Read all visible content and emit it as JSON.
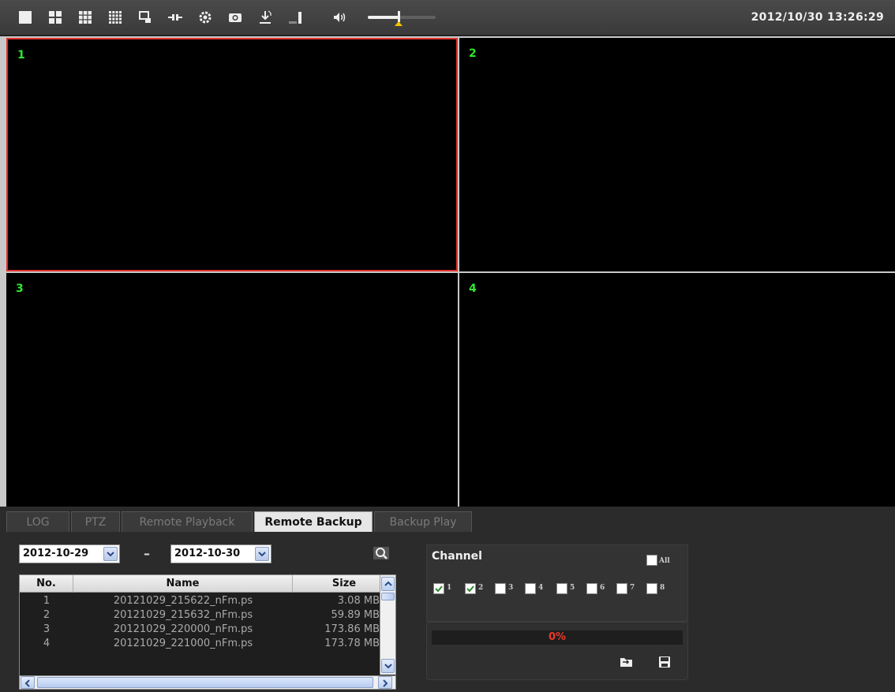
{
  "toolbar": {
    "icons": [
      "layout-1-icon",
      "layout-4-icon",
      "layout-9-icon",
      "layout-16-icon",
      "fullscreen-icon",
      "connect-icon",
      "settings-icon",
      "snapshot-camera-icon",
      "record-download-icon",
      "signal-icon",
      "volume-icon"
    ],
    "volume_level": 0.45,
    "datetime": "2012/10/30 13:26:29"
  },
  "video_panes": [
    {
      "label": "1",
      "selected": true
    },
    {
      "label": "2",
      "selected": false
    },
    {
      "label": "3",
      "selected": false
    },
    {
      "label": "4",
      "selected": false
    }
  ],
  "tabs": [
    {
      "label": "LOG",
      "active": false
    },
    {
      "label": "PTZ",
      "active": false
    },
    {
      "label": "Remote Playback",
      "active": false
    },
    {
      "label": "Remote Backup",
      "active": true
    },
    {
      "label": "Backup Play",
      "active": false
    }
  ],
  "backup": {
    "date_from": "2012-10-29",
    "date_separator": "–",
    "date_to": "2012-10-30",
    "table": {
      "headers": [
        "No.",
        "Name",
        "Size"
      ],
      "rows": [
        {
          "no": "1",
          "name": "20121029_215622_nFm.ps",
          "size": "3.08 MB"
        },
        {
          "no": "2",
          "name": "20121029_215632_nFm.ps",
          "size": "59.89 MB"
        },
        {
          "no": "3",
          "name": "20121029_220000_nFm.ps",
          "size": "173.86 MB"
        },
        {
          "no": "4",
          "name": "20121029_221000_nFm.ps",
          "size": "173.78 MB"
        }
      ]
    },
    "channel": {
      "title": "Channel",
      "all_label": "All",
      "all_checked": false,
      "channels": [
        {
          "label": "1",
          "checked": true
        },
        {
          "label": "2",
          "checked": true
        },
        {
          "label": "3",
          "checked": false
        },
        {
          "label": "4",
          "checked": false
        },
        {
          "label": "5",
          "checked": false
        },
        {
          "label": "6",
          "checked": false
        },
        {
          "label": "7",
          "checked": false
        },
        {
          "label": "8",
          "checked": false
        }
      ]
    },
    "progress": {
      "value": 0,
      "text": "0%"
    },
    "colors": {
      "progress_text": "#e83a2a",
      "pane_label": "#2fe82f",
      "selected_border": "#e0302a"
    }
  }
}
